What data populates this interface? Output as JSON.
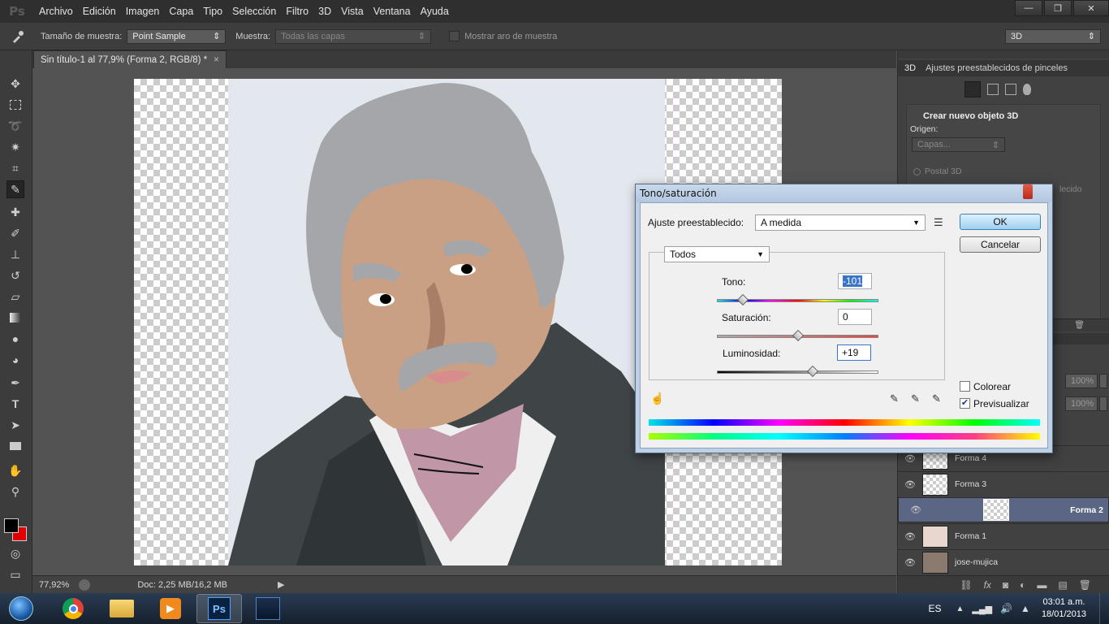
{
  "app": {
    "logo": "Ps",
    "menu": [
      "Archivo",
      "Edición",
      "Imagen",
      "Capa",
      "Tipo",
      "Selección",
      "Filtro",
      "3D",
      "Vista",
      "Ventana",
      "Ayuda"
    ],
    "window_controls": [
      "—",
      "❐",
      "✕"
    ]
  },
  "options_bar": {
    "sample_size_label": "Tamaño de muestra:",
    "sample_size_value": "Point Sample",
    "sample_label": "Muestra:",
    "sample_value": "Todas las capas",
    "show_ring_label": "Mostrar aro de muestra",
    "workspace_value": "3D"
  },
  "document": {
    "tab_title": "Sin título-1 al 77,9% (Forma 2, RGB/8) *",
    "tab_close": "×"
  },
  "status": {
    "zoom": "77,92%",
    "doc_info": "Doc: 2,25 MB/16,2 MB"
  },
  "panel_3d": {
    "tab_3d": "3D",
    "tab_brushes": "Ajustes preestablecidos de pinceles",
    "create_title": "Crear nuevo objeto 3D",
    "origin_label": "Origen:",
    "origin_value": "Capas...",
    "postal_label": "Postal 3D",
    "partial_text": "lecido"
  },
  "layers": {
    "opacity_value": "100%",
    "fill_value": "100%",
    "items": [
      {
        "name": "Forma 4",
        "selected": false
      },
      {
        "name": "Forma 3",
        "selected": false
      },
      {
        "name": "Forma 2",
        "selected": true
      },
      {
        "name": "Forma 1",
        "selected": false
      },
      {
        "name": "jose-mujica",
        "selected": false
      }
    ],
    "footer_icons": [
      "link-icon",
      "fx-icon",
      "mask-icon",
      "adjustment-icon",
      "folder-icon",
      "new-layer-icon",
      "trash-icon"
    ]
  },
  "dialog": {
    "title": "Tono/saturación",
    "preset_label": "Ajuste preestablecido:",
    "preset_value": "A medida",
    "channel_value": "Todos",
    "hue_label": "Tono:",
    "hue_value": "-101",
    "saturation_label": "Saturación:",
    "saturation_value": "0",
    "lightness_label": "Luminosidad:",
    "lightness_value": "+19",
    "ok_label": "OK",
    "cancel_label": "Cancelar",
    "colorize_label": "Colorear",
    "preview_label": "Previsualizar",
    "preview_checked": true,
    "colorize_checked": false
  },
  "taskbar": {
    "lang": "ES",
    "time": "03:01 a.m.",
    "date": "18/01/2013",
    "apps": [
      "chrome-icon",
      "explorer-icon",
      "media-player-icon",
      "photoshop-icon",
      "app-icon"
    ]
  }
}
